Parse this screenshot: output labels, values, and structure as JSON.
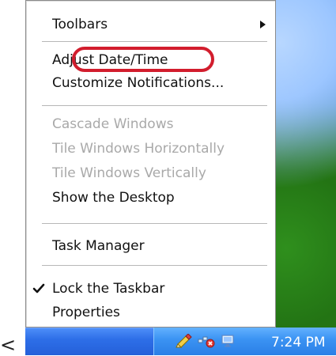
{
  "menu": {
    "items": [
      {
        "label": "Toolbars",
        "disabled": false,
        "submenu": true
      },
      {
        "label": "Adjust Date/Time",
        "disabled": false
      },
      {
        "label": "Customize Notifications...",
        "disabled": false
      },
      {
        "label": "Cascade Windows",
        "disabled": true
      },
      {
        "label": "Tile Windows Horizontally",
        "disabled": true
      },
      {
        "label": "Tile Windows Vertically",
        "disabled": true
      },
      {
        "label": "Show the Desktop",
        "disabled": false
      },
      {
        "label": "Task Manager",
        "disabled": false
      },
      {
        "label": "Lock the Taskbar",
        "disabled": false,
        "checked": true
      },
      {
        "label": "Properties",
        "disabled": false
      }
    ]
  },
  "taskbar": {
    "clock": "7:24 PM"
  },
  "misc": {
    "left_caret": "<"
  },
  "colors": {
    "highlight_ring": "#d21d2d"
  }
}
